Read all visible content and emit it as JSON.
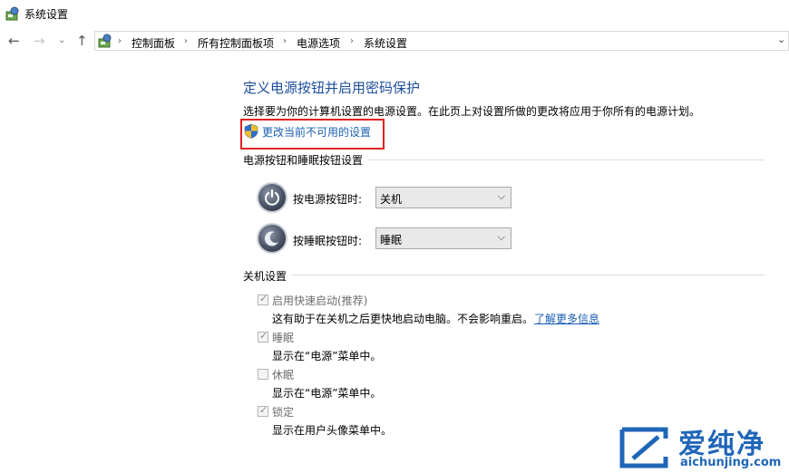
{
  "window": {
    "title": "系统设置"
  },
  "breadcrumb": [
    "控制面板",
    "所有控制面板项",
    "电源选项",
    "系统设置"
  ],
  "page": {
    "heading": "定义电源按钮并启用密码保护",
    "description": "选择要为你的计算机设置的电源设置。在此页上对设置所做的更改将应用于你所有的电源计划。",
    "change_link": "更改当前不可用的设置"
  },
  "power_group": {
    "title": "电源按钮和睡眠按钮设置",
    "power_label": "按电源按钮时:",
    "power_value": "关机",
    "sleep_label": "按睡眠按钮时:",
    "sleep_value": "睡眠"
  },
  "shutdown_group": {
    "title": "关机设置",
    "options": [
      {
        "label": "启用快速启动(推荐)",
        "desc": "这有助于在关机之后更快地启动电脑。不会影响重启。",
        "link": "了解更多信息",
        "checked": true
      },
      {
        "label": "睡眠",
        "desc": "显示在“电源”菜单中。",
        "checked": true
      },
      {
        "label": "休眠",
        "desc": "显示在“电源”菜单中。",
        "checked": false
      },
      {
        "label": "锁定",
        "desc": "显示在用户头像菜单中。",
        "checked": true
      }
    ]
  },
  "watermark": {
    "brand": "爱纯净",
    "url": "aichunjing.com"
  }
}
